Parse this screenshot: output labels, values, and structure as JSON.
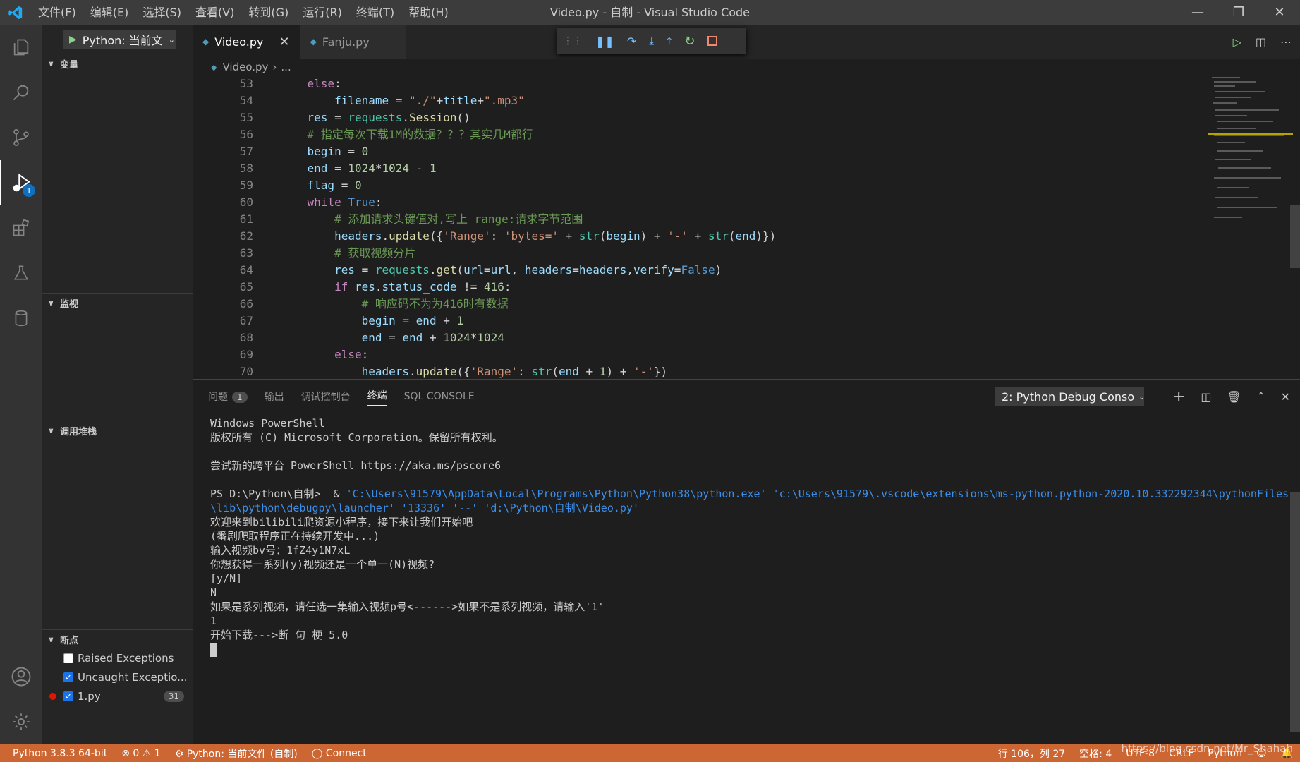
{
  "titlebar": {
    "title": "Video.py - 自制 - Visual Studio Code",
    "menu": [
      "文件(F)",
      "编辑(E)",
      "选择(S)",
      "查看(V)",
      "转到(G)",
      "运行(R)",
      "终端(T)",
      "帮助(H)"
    ]
  },
  "activity": {
    "debug_badge": "1"
  },
  "sidebar": {
    "run_config": "Python: 当前文",
    "sections": {
      "variables": "变量",
      "watch": "监视",
      "callstack": "调用堆栈",
      "breakpoints": "断点"
    },
    "breakpoints": [
      {
        "label": "Raised Exceptions",
        "checked": false
      },
      {
        "label": "Uncaught Exceptio...",
        "checked": true
      },
      {
        "label": "1.py",
        "checked": true,
        "count": "31"
      }
    ]
  },
  "editor": {
    "tabs": [
      {
        "label": "Video.py",
        "active": true
      },
      {
        "label": "Fanju.py",
        "active": false
      }
    ],
    "breadcrumb": {
      "file": "Video.py",
      "rest": "..."
    },
    "line_numbers": [
      "53",
      "54",
      "55",
      "56",
      "57",
      "58",
      "59",
      "60",
      "61",
      "62",
      "63",
      "64",
      "65",
      "66",
      "67",
      "68",
      "69",
      "70"
    ]
  },
  "panel": {
    "tabs": [
      {
        "label": "问题",
        "badge": "1"
      },
      {
        "label": "输出"
      },
      {
        "label": "调试控制台"
      },
      {
        "label": "终端",
        "active": true
      },
      {
        "label": "SQL CONSOLE"
      }
    ],
    "terminal_select": "2: Python Debug Conso",
    "terminal": {
      "l1": "Windows PowerShell",
      "l2": "版权所有 (C) Microsoft Corporation。保留所有权利。",
      "l3": "尝试新的跨平台 PowerShell https://aka.ms/pscore6",
      "prompt": "PS D:\\Python\\自制>  & ",
      "cmd": "'C:\\Users\\91579\\AppData\\Local\\Programs\\Python\\Python38\\python.exe' 'c:\\Users\\91579\\.vscode\\extensions\\ms-python.python-2020.10.332292344\\pythonFiles\\lib\\python\\debugpy\\launcher' '13336' '--' 'd:\\Python\\自制\\Video.py'",
      "out": [
        "欢迎来到bilibili爬资源小程序，接下来让我们开始吧",
        "(番剧爬取程序正在持续开发中...)",
        "输入视频bv号：1fZ4y1N7xL",
        "你想获得一系列(y)视频还是一个单一(N)视频?",
        "[y/N]",
        "N",
        "如果是系列视频，请任选一集输入视频p号<------>如果不是系列视频，请输入'1'",
        "1",
        "开始下载--->断 句 梗 5.0"
      ]
    }
  },
  "statusbar": {
    "python": "Python 3.8.3 64-bit",
    "errors": "0",
    "warnings": "1",
    "debug_cfg": "Python: 当前文件 (自制)",
    "connect": "Connect",
    "position": "行 106，列 27",
    "spaces": "空格: 4",
    "encoding": "UTF-8",
    "eol": "CRLF",
    "language": "Python",
    "watermark": "https://blog.csdn.net/Mr_Shahah"
  },
  "colors": {
    "statusbar": "#cc6633",
    "activity": "#333333",
    "sidebar": "#252526",
    "editor": "#1e1e1e"
  }
}
